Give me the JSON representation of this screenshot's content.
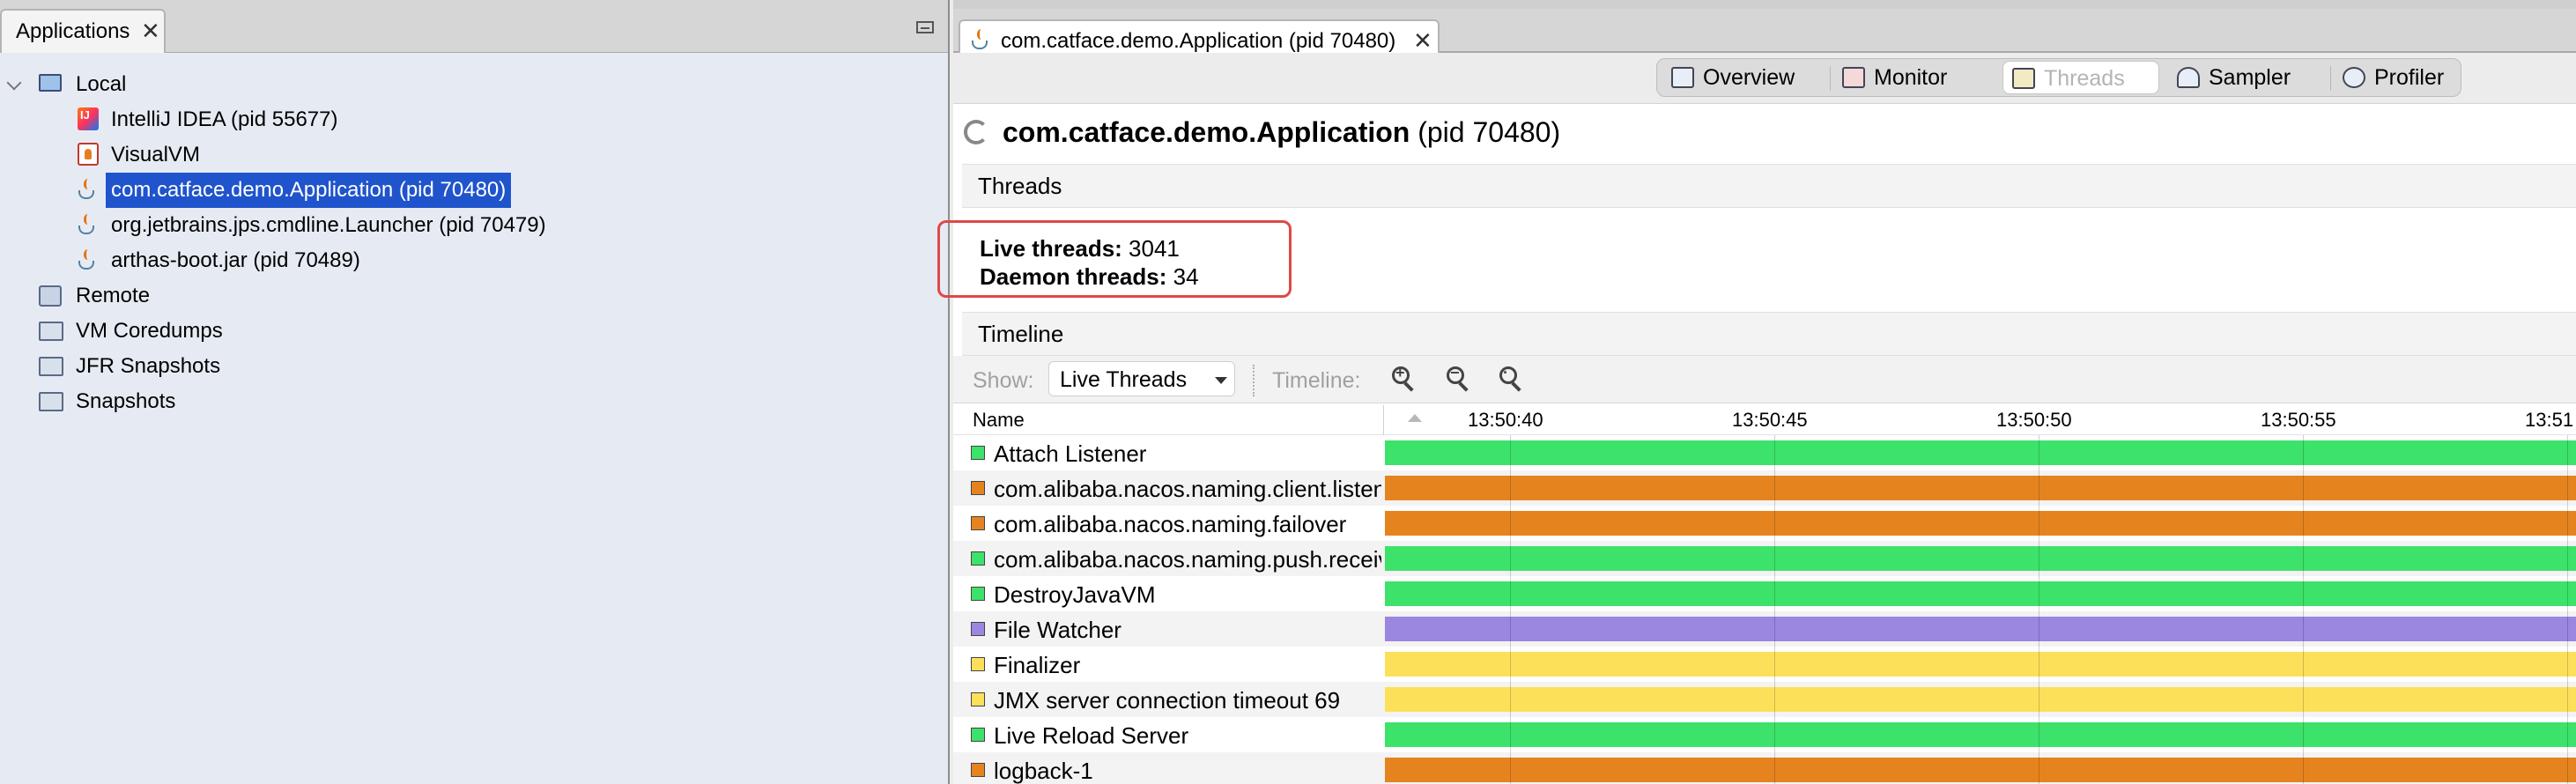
{
  "left_panel": {
    "tab_label": "Applications",
    "close_glyph": "✕",
    "tree": {
      "local": "Local",
      "apps": [
        {
          "label": "IntelliJ IDEA (pid 55677)",
          "icon": "intellij-icon"
        },
        {
          "label": "VisualVM",
          "icon": "visualvm-icon"
        },
        {
          "label": "com.catface.demo.Application (pid 70480)",
          "icon": "java-icon",
          "selected": true
        },
        {
          "label": "org.jetbrains.jps.cmdline.Launcher (pid 70479)",
          "icon": "java-icon"
        },
        {
          "label": "arthas-boot.jar (pid 70489)",
          "icon": "java-icon"
        }
      ],
      "remote": "Remote",
      "vm_coredumps": "VM Coredumps",
      "jfr_snapshots": "JFR Snapshots",
      "snapshots": "Snapshots"
    }
  },
  "right_panel": {
    "doc_tab_label": "com.catface.demo.Application (pid 70480)",
    "close_glyph": "✕",
    "views": {
      "overview": "Overview",
      "monitor": "Monitor",
      "threads": "Threads",
      "sampler": "Sampler",
      "profiler": "Profiler",
      "active": "threads"
    },
    "app_title_bold": "com.catface.demo.Application",
    "app_title_pid": " (pid 70480)",
    "threads_section": "Threads",
    "stats": {
      "live_label": "Live threads:",
      "live_value": " 3041",
      "daemon_label": "Daemon threads:",
      "daemon_value": " 34"
    },
    "timeline_section": "Timeline",
    "timeline_toolbar": {
      "show_label": "Show:",
      "show_value": "Live Threads",
      "timeline_label": "Timeline:"
    },
    "table": {
      "name_header": "Name",
      "ticks": [
        "13:50:40",
        "13:50:45",
        "13:50:50",
        "13:50:55",
        "13:51"
      ],
      "rows": [
        {
          "name": "Attach Listener",
          "state": "running"
        },
        {
          "name": "com.alibaba.nacos.naming.client.listener",
          "state": "park"
        },
        {
          "name": "com.alibaba.nacos.naming.failover",
          "state": "park"
        },
        {
          "name": "com.alibaba.nacos.naming.push.receiver",
          "state": "running"
        },
        {
          "name": "DestroyJavaVM",
          "state": "running"
        },
        {
          "name": "File Watcher",
          "state": "sleeping"
        },
        {
          "name": "Finalizer",
          "state": "wait"
        },
        {
          "name": "JMX server connection timeout 69",
          "state": "wait"
        },
        {
          "name": "Live Reload Server",
          "state": "running"
        },
        {
          "name": "logback-1",
          "state": "park"
        }
      ]
    },
    "state_colors": {
      "running": "#3ce26a",
      "park": "#e5841f",
      "sleeping": "#9b86e0",
      "wait": "#fde05a"
    }
  }
}
